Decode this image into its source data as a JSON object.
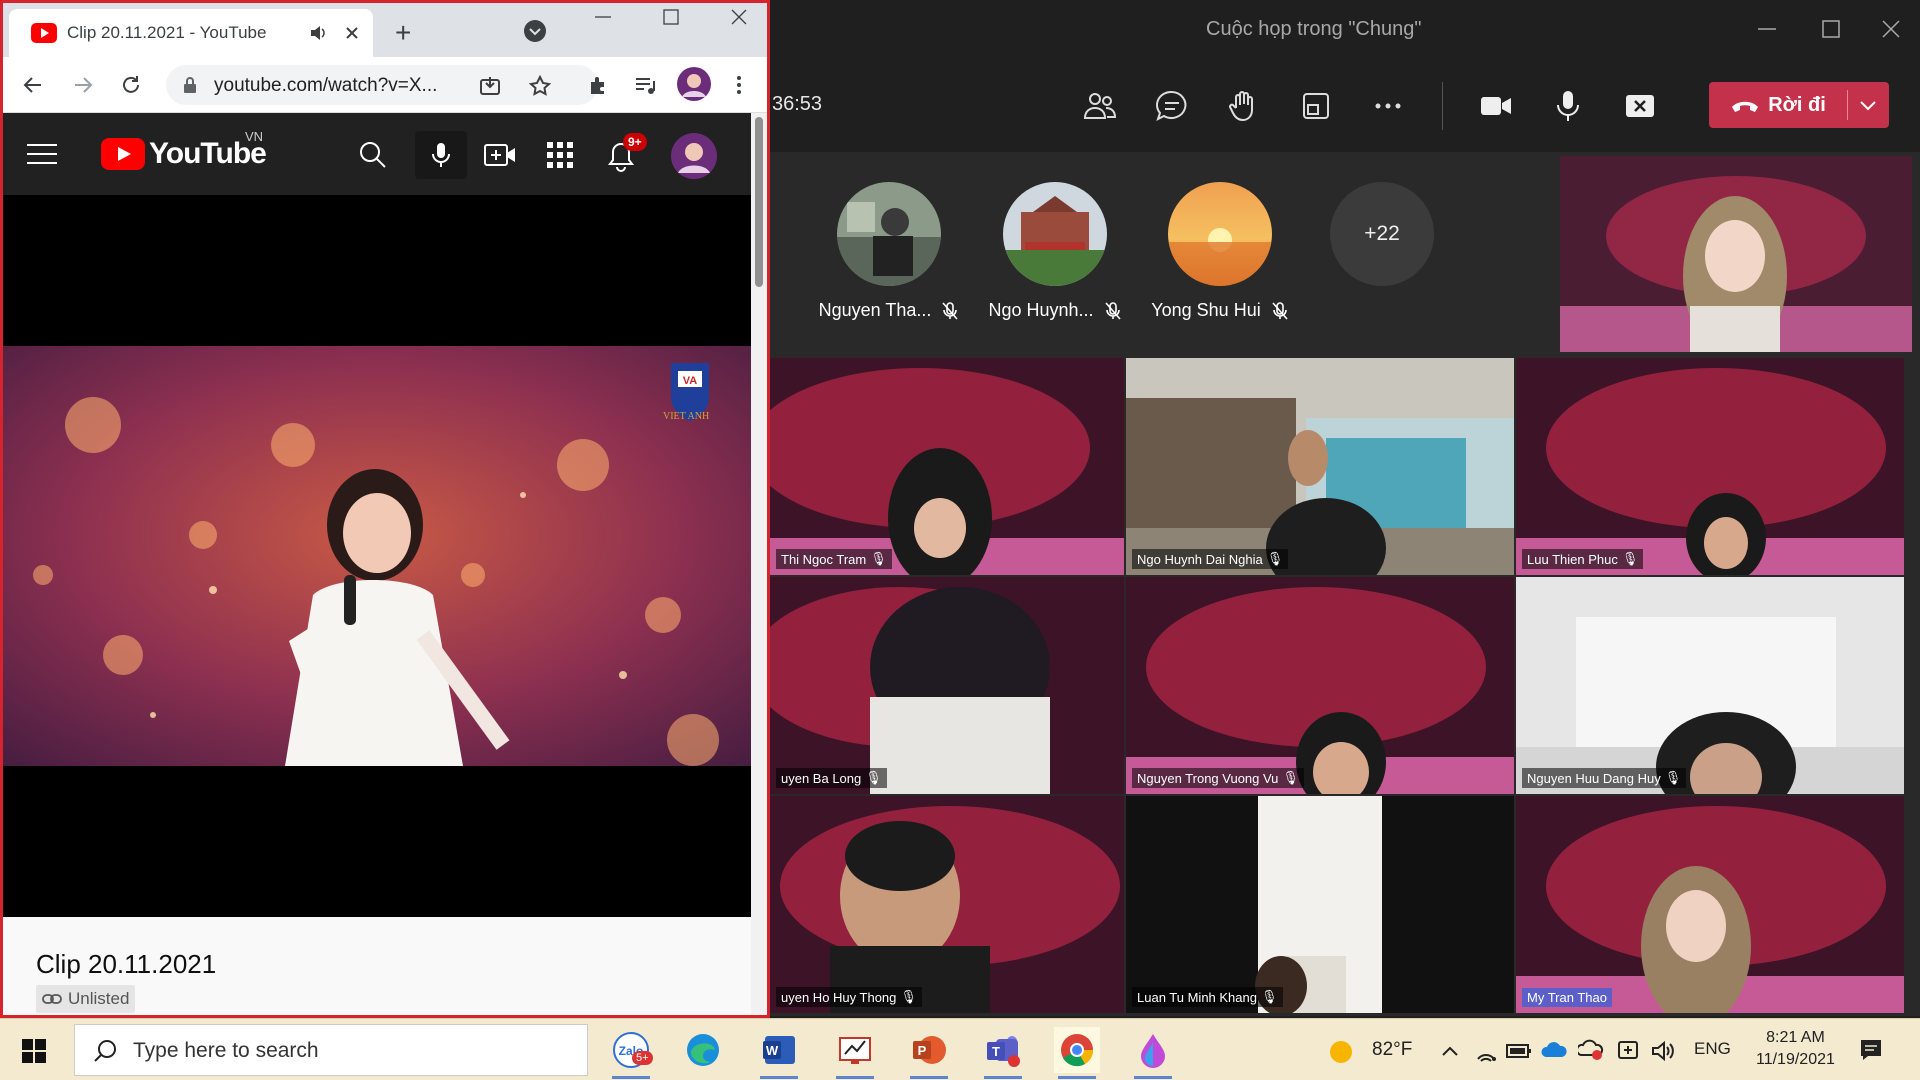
{
  "teams": {
    "window_title": "Cuộc họp trong \"Chung\"",
    "timer": "36:53",
    "leave_label": "Rời đi",
    "toolbar_icons": [
      "people-icon",
      "chat-icon",
      "raise-hand-icon",
      "share-tray-icon",
      "more-icon",
      "camera-icon",
      "mic-icon",
      "share-stop-icon"
    ],
    "audience": [
      {
        "name": "Nguyen Tha...",
        "muted": true
      },
      {
        "name": "Ngo Huynh...",
        "muted": true
      },
      {
        "name": "Yong Shu Hui",
        "muted": true
      }
    ],
    "more_people": "+22",
    "tiles": [
      {
        "name": "Thi Ngoc Tram"
      },
      {
        "name": "Ngo Huynh Dai Nghia"
      },
      {
        "name": "Luu Thien Phuc"
      },
      {
        "name": "uyen Ba Long"
      },
      {
        "name": "Nguyen Trong Vuong Vu"
      },
      {
        "name": "Nguyen Huu Dang Huy"
      },
      {
        "name": "uyen Ho Huy  Thong"
      },
      {
        "name": "Luan Tu Minh Khang"
      },
      {
        "name": "My Tran Thao"
      }
    ]
  },
  "chrome": {
    "tab_title": "Clip 20.11.2021 - YouTube",
    "url": "youtube.com/watch?v=X...",
    "new_tab": "+"
  },
  "youtube": {
    "logo_text": "YouTube",
    "region": "VN",
    "notification_count": "9+",
    "video_title": "Clip 20.11.2021",
    "visibility": "Unlisted",
    "watermark": "VIET ANH"
  },
  "taskbar": {
    "search_placeholder": "Type here to search",
    "zalo_badge": "5+",
    "weather": "82°F",
    "language": "ENG",
    "time": "8:21 AM",
    "date": "11/19/2021"
  },
  "colors": {
    "teams_bg": "#292929",
    "leave_red": "#c4314b",
    "chrome_border": "#d6242f",
    "yt_red": "#ff0000",
    "taskbar_bg": "#f3ead0"
  }
}
